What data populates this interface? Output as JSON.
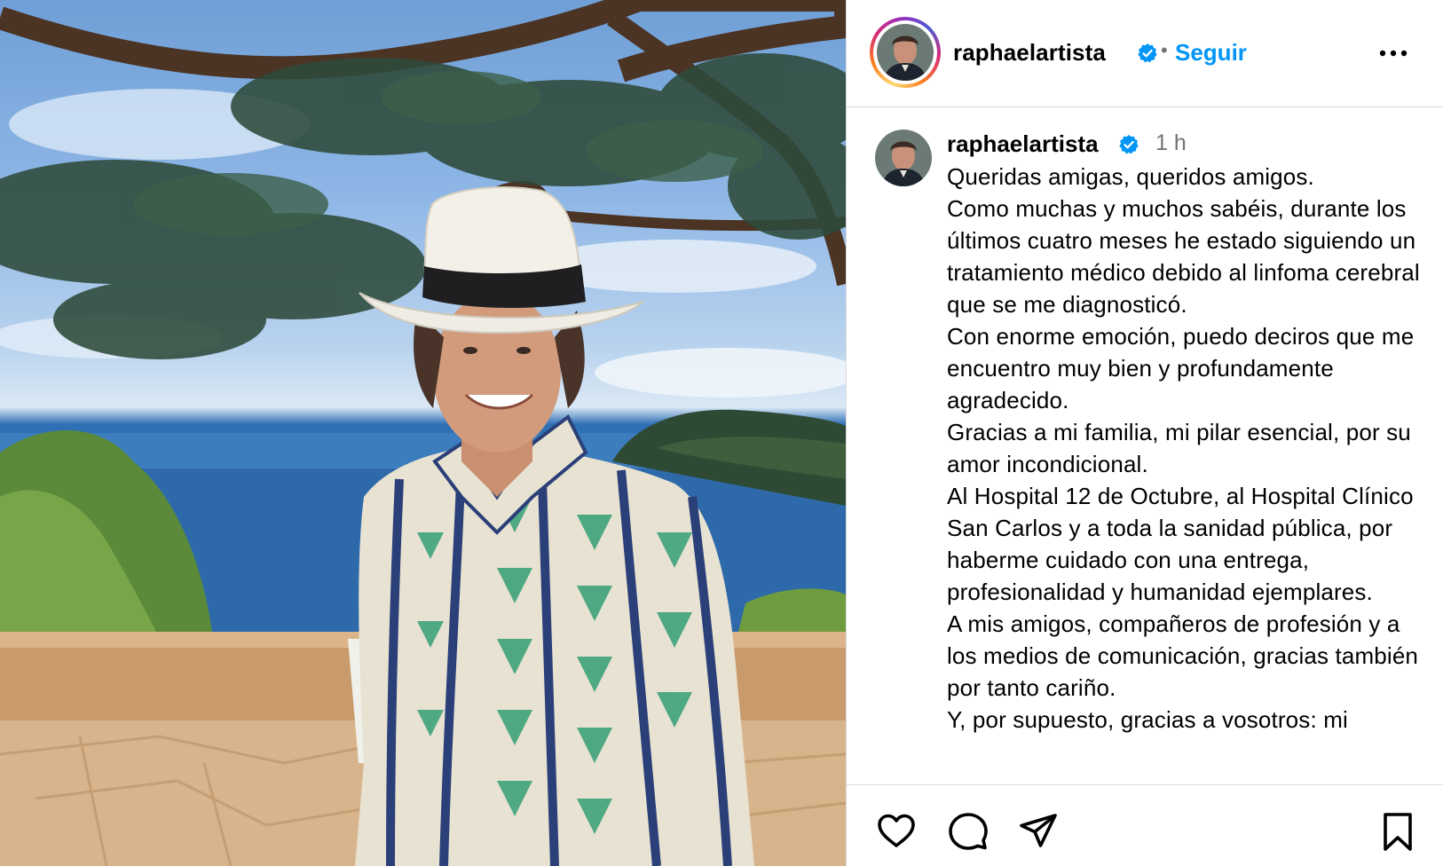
{
  "post": {
    "author": {
      "username": "raphaelartista",
      "verified": true,
      "avatar": "profile-photo"
    },
    "header": {
      "separator": "•",
      "follow_label": "Seguir",
      "more_icon": "more-horizontal-icon"
    },
    "caption": {
      "username": "raphaelartista",
      "time": "1 h",
      "text": "Queridas amigas, queridos amigos.\nComo muchas y muchos sabéis, durante los últimos cuatro meses he estado siguiendo un tratamiento médico debido al linfoma cerebral que se me diagnosticó.\nCon enorme emoción, puedo deciros que me encuentro muy bien y profundamente agradecido.\nGracias a mi familia, mi pilar esencial, por su amor incondicional.\nAl Hospital 12 de Octubre, al Hospital Clínico San Carlos y a toda la sanidad pública, por haberme cuidado con una entrega, profesionalidad y humanidad ejemplares.\nA mis amigos, compañeros de profesión y a los medios de comunicación, gracias también por tanto cariño.\nY, por supuesto, gracias a vosotros: mi"
    },
    "actions": {
      "like_icon": "heart-icon",
      "comment_icon": "comment-icon",
      "share_icon": "share-icon",
      "save_icon": "bookmark-icon"
    },
    "image": "photo-man-in-hat-by-the-sea"
  },
  "colors": {
    "accent": "#0095f6",
    "verified": "#0095f6",
    "secondary_text": "#737373",
    "divider": "#dbdbdb"
  }
}
